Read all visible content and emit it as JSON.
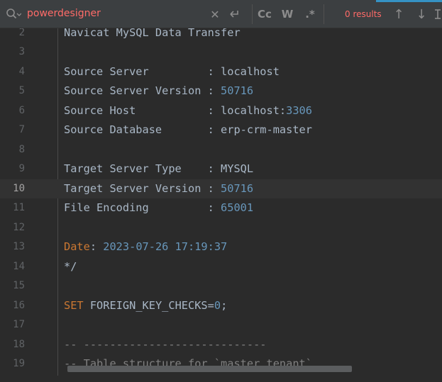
{
  "search": {
    "query": "powerdesigner",
    "results_text": "0 results",
    "buttons": {
      "clear": "✕",
      "replace": "⮐",
      "match_case": "Cc",
      "words": "W",
      "regex": ".*",
      "prev": "↑",
      "next": "↓"
    }
  },
  "editor": {
    "active_line": 10,
    "lines": [
      {
        "num": "2",
        "tokens": [
          {
            "t": "Navicat MySQL Data Transfer",
            "k": "plain"
          }
        ]
      },
      {
        "num": "3",
        "tokens": []
      },
      {
        "num": "4",
        "tokens": [
          {
            "t": "Source Server         : ",
            "k": "plain"
          },
          {
            "t": "localhost",
            "k": "plain"
          }
        ]
      },
      {
        "num": "5",
        "tokens": [
          {
            "t": "Source Server Version : ",
            "k": "plain"
          },
          {
            "t": "50716",
            "k": "num"
          }
        ]
      },
      {
        "num": "6",
        "tokens": [
          {
            "t": "Source Host           : ",
            "k": "plain"
          },
          {
            "t": "localhost:",
            "k": "plain"
          },
          {
            "t": "3306",
            "k": "num"
          }
        ]
      },
      {
        "num": "7",
        "tokens": [
          {
            "t": "Source Database       : ",
            "k": "plain"
          },
          {
            "t": "erp-crm-master",
            "k": "plain"
          }
        ]
      },
      {
        "num": "8",
        "tokens": []
      },
      {
        "num": "9",
        "tokens": [
          {
            "t": "Target Server Type    : ",
            "k": "plain"
          },
          {
            "t": "MYSQL",
            "k": "plain"
          }
        ]
      },
      {
        "num": "10",
        "tokens": [
          {
            "t": "Target Server Version : ",
            "k": "plain"
          },
          {
            "t": "50716",
            "k": "num"
          }
        ]
      },
      {
        "num": "11",
        "tokens": [
          {
            "t": "File Encoding         : ",
            "k": "plain"
          },
          {
            "t": "65001",
            "k": "num"
          }
        ]
      },
      {
        "num": "12",
        "tokens": []
      },
      {
        "num": "13",
        "tokens": [
          {
            "t": "Date",
            "k": "kw"
          },
          {
            "t": ": ",
            "k": "plain"
          },
          {
            "t": "2023-07-26 17:19:37",
            "k": "num"
          }
        ]
      },
      {
        "num": "14",
        "tokens": [
          {
            "t": "*/",
            "k": "plain"
          }
        ]
      },
      {
        "num": "15",
        "tokens": []
      },
      {
        "num": "16",
        "tokens": [
          {
            "t": "SET",
            "k": "kw"
          },
          {
            "t": " FOREIGN_KEY_CHECKS=",
            "k": "plain"
          },
          {
            "t": "0",
            "k": "num"
          },
          {
            "t": ";",
            "k": "plain"
          }
        ]
      },
      {
        "num": "17",
        "tokens": []
      },
      {
        "num": "18",
        "tokens": [
          {
            "t": "-- ----------------------------",
            "k": "cm"
          }
        ]
      },
      {
        "num": "19",
        "tokens": [
          {
            "t": "-- Table structure for `master_tenant`",
            "k": "cm"
          }
        ]
      }
    ]
  },
  "colors": {
    "background": "#2b2b2b",
    "search_bar": "#3c3f41",
    "search_text": "#ff6b68",
    "code_text": "#a9b7c6",
    "number": "#6897bb",
    "keyword": "#cc7832",
    "comment": "#808080",
    "active_line": "#323232",
    "accent": "#3592c4"
  }
}
